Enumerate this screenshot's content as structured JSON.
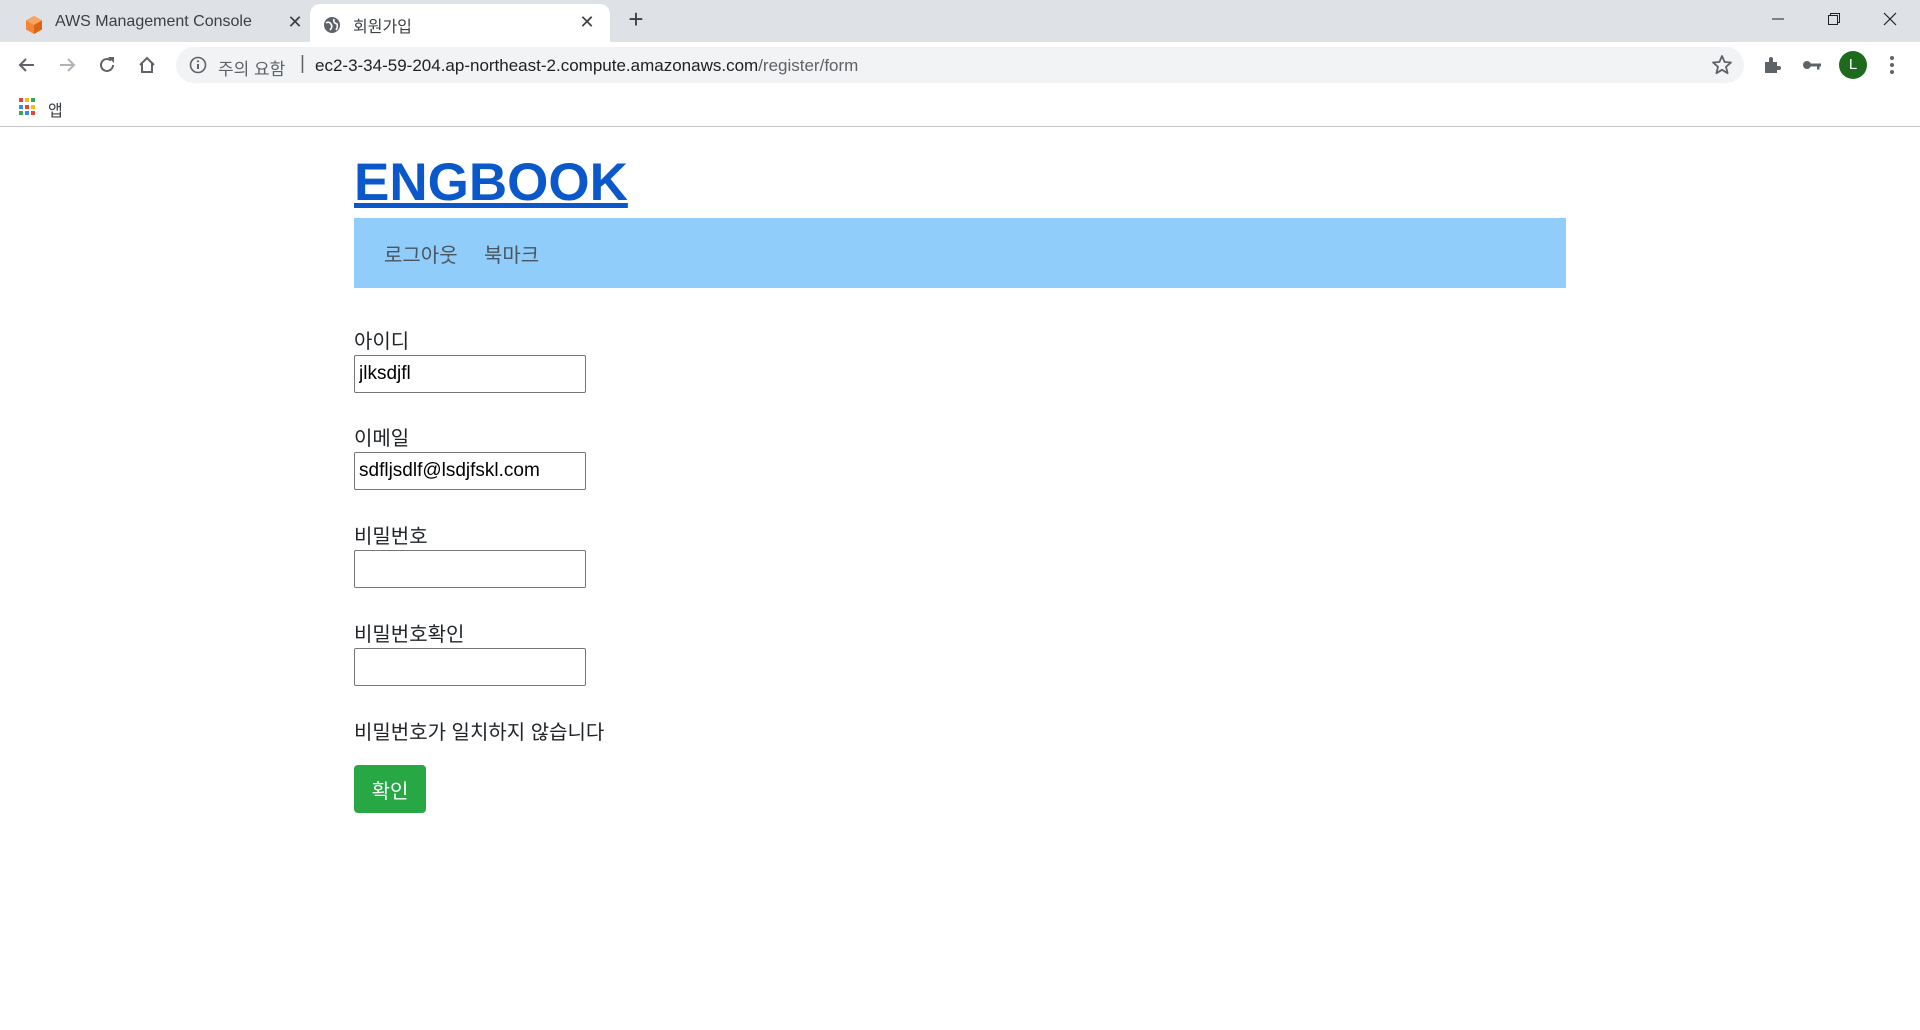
{
  "browser": {
    "tabs": [
      {
        "title": "AWS Management Console",
        "active": false
      },
      {
        "title": "회원가입",
        "active": true
      }
    ],
    "omnibox": {
      "security_warning": "주의 요함",
      "separator": "|",
      "url_host": "ec2-3-34-59-204.ap-northeast-2.compute.amazonaws.com",
      "url_path": "/register/form"
    },
    "profile_initial": "L",
    "bookmarks_bar": {
      "apps_label": "앱"
    },
    "icons": [
      "back-icon",
      "forward-icon",
      "reload-icon",
      "home-icon",
      "info-icon",
      "star-icon",
      "extensions-icon",
      "key-icon",
      "more-icon",
      "apps-icon",
      "globe-icon",
      "aws-cube-icon"
    ]
  },
  "site": {
    "brand": "ENGBOOK",
    "nav": {
      "logout": "로그아웃",
      "bookmark": "북마크"
    }
  },
  "form": {
    "id": {
      "label": "아이디",
      "value": "jlksdjfl"
    },
    "email": {
      "label": "이메일",
      "value": "sdfljsdlf@lsdjfskl.com"
    },
    "password": {
      "label": "비밀번호",
      "value": ""
    },
    "password_confirm": {
      "label": "비밀번호확인",
      "value": ""
    },
    "error_message": "비밀번호가 일치하지 않습니다",
    "submit_label": "확인"
  },
  "colors": {
    "navbar_bg": "#90cdfa",
    "brand_link": "#0a58ca",
    "submit_bg": "#28a745",
    "aws_orange": "#f58536"
  }
}
